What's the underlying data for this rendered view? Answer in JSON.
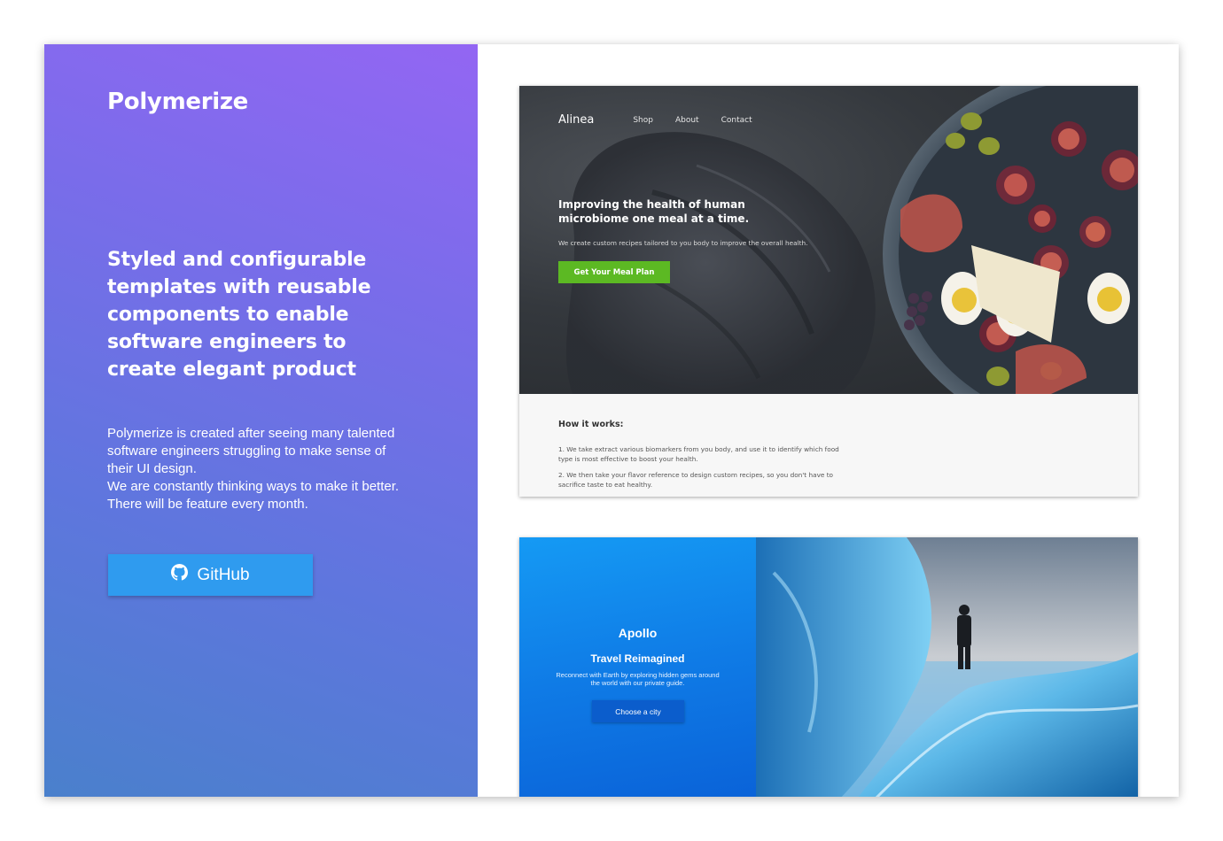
{
  "brand": "Polymerize",
  "headline": "Styled and configurable templates with reusable components to enable software engineers to create elegant product",
  "description": {
    "line1": "Polymerize is created after seeing many talented software engineers struggling to make sense of their UI design.",
    "line2": "We are constantly thinking ways to make it better. There will be feature every month."
  },
  "github_button": {
    "label": "GitHub",
    "icon": "github-icon"
  },
  "alinea": {
    "logo": "Alinea",
    "nav": [
      "Shop",
      "About",
      "Contact"
    ],
    "hero_title": "Improving the health of human microbiome one meal at a time.",
    "hero_subtitle": "We create custom recipes tailored to you body to improve the overall health.",
    "cta": "Get Your Meal Plan",
    "how_title": "How it works:",
    "steps": [
      "1. We take extract various biomarkers from you body, and use it to identify which food type is most effective to boost your health.",
      "2. We then take your flavor reference to design custom recipes, so you don't have to sacrifice taste to eat healthy."
    ]
  },
  "apollo": {
    "name": "Apollo",
    "tagline": "Travel Reimagined",
    "description": "Reconnect with Earth by exploring hidden gems around the world with our private guide.",
    "cta": "Choose a city"
  },
  "colors": {
    "gradient_top": "#9366f3",
    "gradient_bottom": "#4a80cc",
    "github_button": "#2f9bef",
    "alinea_cta": "#5cb923",
    "apollo_blue": "#0f7be6"
  }
}
